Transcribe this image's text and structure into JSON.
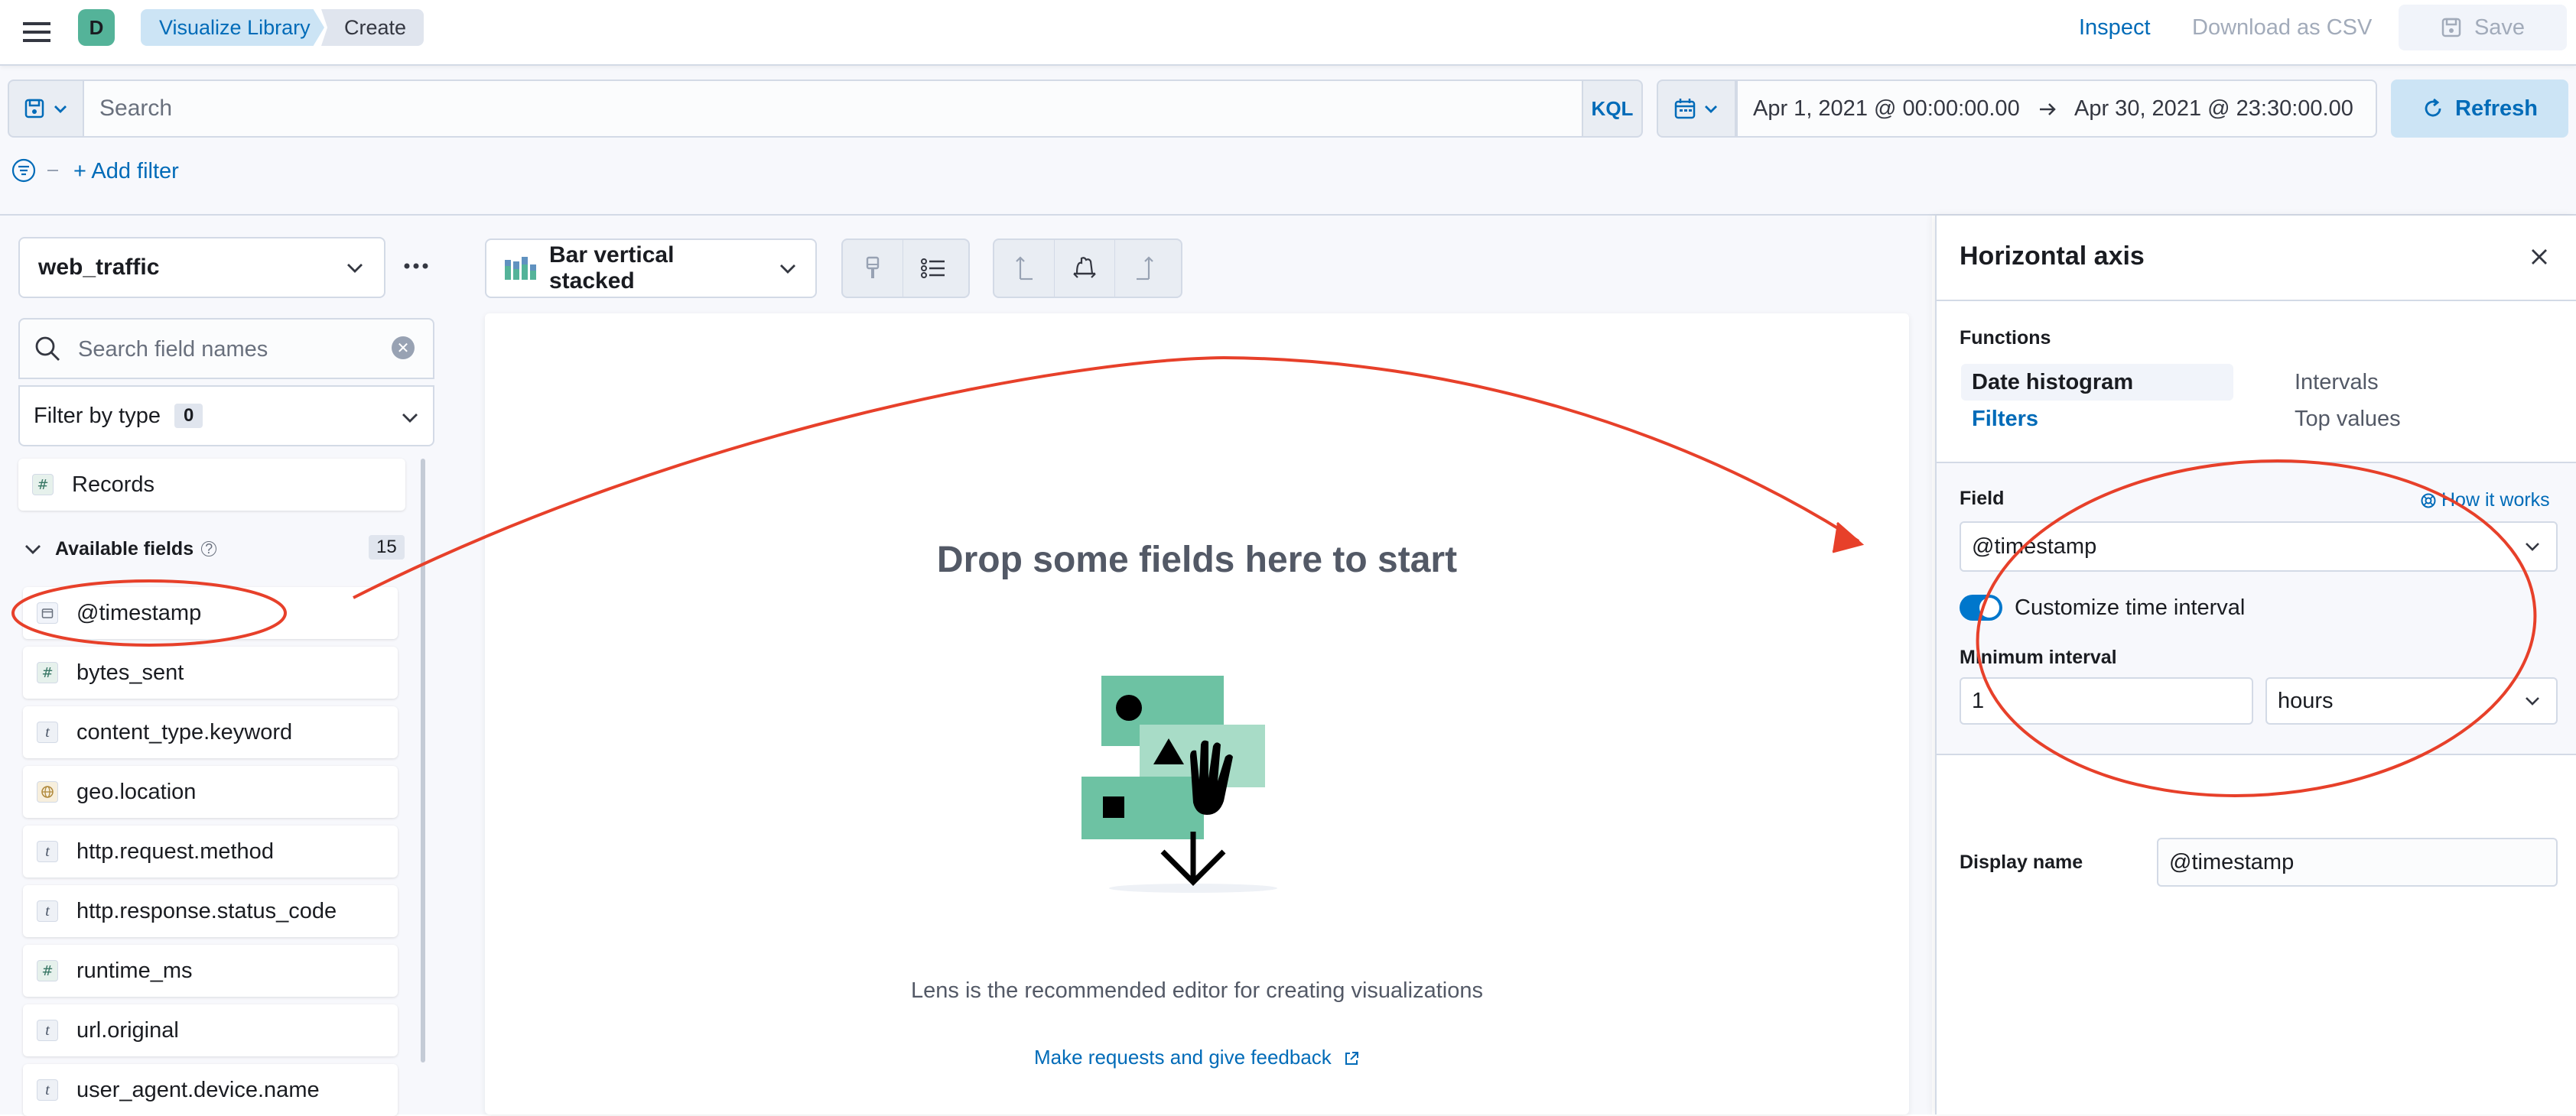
{
  "header": {
    "breadcrumbs": [
      "Visualize Library",
      "Create"
    ],
    "avatar_initial": "D",
    "inspect_label": "Inspect",
    "download_label": "Download as CSV",
    "save_label": "Save"
  },
  "query_bar": {
    "search_placeholder": "Search",
    "language_label": "KQL",
    "date_start": "Apr 1, 2021 @ 00:00:00.00",
    "date_end": "Apr 30, 2021 @ 23:30:00.00",
    "refresh_label": "Refresh",
    "add_filter_label": "+ Add filter"
  },
  "left_panel": {
    "index_pattern": "web_traffic",
    "field_search_placeholder": "Search field names",
    "filter_by_type_label": "Filter by type",
    "filter_by_type_count": "0",
    "records_label": "Records",
    "available_fields_label": "Available fields",
    "available_fields_count": "15",
    "fields": [
      {
        "name": "@timestamp",
        "type": "date",
        "icon": "calendar-icon"
      },
      {
        "name": "bytes_sent",
        "type": "number",
        "icon": "number-icon"
      },
      {
        "name": "content_type.keyword",
        "type": "string",
        "icon": "string-icon"
      },
      {
        "name": "geo.location",
        "type": "geo",
        "icon": "globe-icon"
      },
      {
        "name": "http.request.method",
        "type": "string",
        "icon": "string-icon"
      },
      {
        "name": "http.response.status_code",
        "type": "string",
        "icon": "string-icon"
      },
      {
        "name": "runtime_ms",
        "type": "number",
        "icon": "number-icon"
      },
      {
        "name": "url.original",
        "type": "string",
        "icon": "string-icon"
      },
      {
        "name": "user_agent.device.name",
        "type": "string",
        "icon": "string-icon"
      }
    ]
  },
  "workspace": {
    "chart_type_label": "Bar vertical stacked",
    "empty_title": "Drop some fields here to start",
    "lens_text": "Lens is the recommended editor for creating visualizations",
    "feedback_link": "Make requests and give feedback"
  },
  "right_panel": {
    "title": "Horizontal axis",
    "functions_label": "Functions",
    "functions": {
      "date_histogram": "Date histogram",
      "intervals": "Intervals",
      "filters": "Filters",
      "top_values": "Top values"
    },
    "field_label": "Field",
    "how_it_works_label": "How it works",
    "field_value": "@timestamp",
    "customize_label": "Customize time interval",
    "customize_enabled": true,
    "min_interval_label": "Minimum interval",
    "interval_value": "1",
    "interval_unit": "hours",
    "display_name_label": "Display name",
    "display_name_value": "@timestamp"
  },
  "colors": {
    "accent": "#006bb8",
    "annotation": "#e7402a",
    "avatar": "#54b399",
    "illustration_green": "#6dc2a3",
    "illustration_light": "#a8dcc7"
  }
}
